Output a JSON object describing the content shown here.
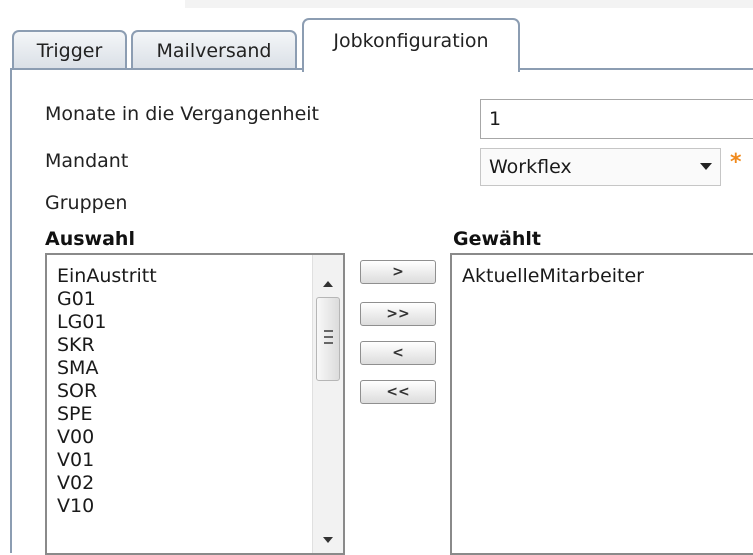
{
  "tabs": [
    {
      "label": "Trigger"
    },
    {
      "label": "Mailversand"
    },
    {
      "label": "Jobkonfiguration"
    }
  ],
  "form": {
    "months_label": "Monate in die Vergangenheit",
    "months_value": "1",
    "client_label": "Mandant",
    "client_value": "Workflex",
    "required_marker": "*",
    "groups_label": "Gruppen"
  },
  "selection": {
    "available_heading": "Auswahl",
    "selected_heading": "Gewählt",
    "available_items": [
      "EinAustritt",
      "G01",
      "LG01",
      "SKR",
      "SMA",
      "SOR",
      "SPE",
      "V00",
      "V01",
      "V02",
      "V10"
    ],
    "selected_items": [
      "AktuelleMitarbeiter"
    ],
    "buttons": {
      "add": ">",
      "add_all": ">>",
      "remove": "<",
      "remove_all": "<<"
    }
  },
  "colors": {
    "tab_border": "#8c9db2",
    "required": "#f08a1c"
  }
}
